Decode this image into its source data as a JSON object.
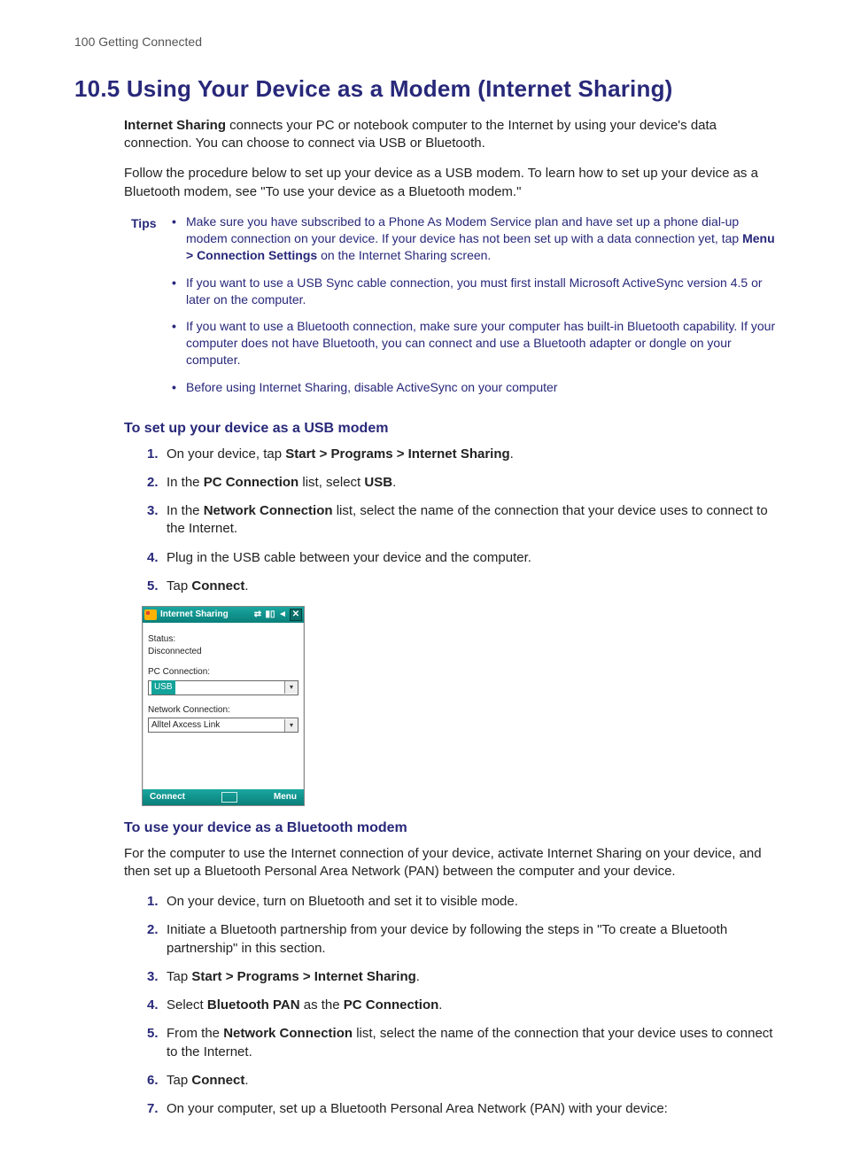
{
  "running_head": "100  Getting Connected",
  "title": "10.5  Using Your Device as a Modem (Internet Sharing)",
  "intro1_a": "Internet Sharing",
  "intro1_b": " connects your PC or notebook computer to the Internet by using your device's data connection. You can choose to connect via USB or Bluetooth.",
  "intro2": "Follow the procedure below to set up your device as a USB modem. To learn how to set up your device as a Bluetooth modem, see \"To use your device as a Bluetooth modem.\"",
  "tips_label": "Tips",
  "tips": [
    {
      "pre": "Make sure you have subscribed to a Phone As Modem Service plan and have set up a phone dial-up modem connection on your device. If your device has not been set up with a data connection yet, tap ",
      "strong": "Menu > Connection Settings",
      "post": " on the Internet Sharing screen."
    },
    {
      "pre": "If you want to use a USB Sync cable connection, you must first install Microsoft ActiveSync version 4.5 or later on the computer.",
      "strong": "",
      "post": ""
    },
    {
      "pre": "If you want to use a Bluetooth connection, make sure your computer has built-in Bluetooth capability. If your computer does not have Bluetooth, you can connect and use a Bluetooth adapter or dongle on your computer.",
      "strong": "",
      "post": ""
    },
    {
      "pre": "Before using Internet Sharing, disable ActiveSync on your computer",
      "strong": "",
      "post": ""
    }
  ],
  "usb_heading": "To set up your device as a USB modem",
  "usb_steps": [
    {
      "num": "1.",
      "pre": "On your device, tap ",
      "strong": "Start > Programs > Internet Sharing",
      "post": "."
    },
    {
      "num": "2.",
      "pre": "In the ",
      "strong": "PC Connection",
      "post": " list, select ",
      "strong2": "USB",
      "post2": "."
    },
    {
      "num": "3.",
      "pre": "In the ",
      "strong": "Network Connection",
      "post": " list, select the name of the connection that your device uses to connect to the Internet."
    },
    {
      "num": "4.",
      "pre": "Plug in the USB cable between your device and the computer.",
      "strong": "",
      "post": ""
    },
    {
      "num": "5.",
      "pre": "Tap ",
      "strong": "Connect",
      "post": "."
    }
  ],
  "shot": {
    "title": "Internet Sharing",
    "status_label": "Status:",
    "status_value": "Disconnected",
    "pc_label": "PC Connection:",
    "pc_value": "USB",
    "net_label": "Network Connection:",
    "net_value": "Alltel Axcess Link",
    "footer_left": "Connect",
    "footer_right": "Menu"
  },
  "bt_heading": "To use your device as a Bluetooth modem",
  "bt_intro": "For the computer to use the Internet connection of your device, activate Internet Sharing on your device, and then set up a Bluetooth Personal Area Network (PAN) between the computer and your device.",
  "bt_steps": [
    {
      "num": "1.",
      "pre": "On your device, turn on Bluetooth and set it to visible mode.",
      "strong": "",
      "post": ""
    },
    {
      "num": "2.",
      "pre": "Initiate a Bluetooth partnership from your device by following the steps in \"To create a Bluetooth partnership\" in this section.",
      "strong": "",
      "post": ""
    },
    {
      "num": "3.",
      "pre": "Tap ",
      "strong": "Start > Programs > Internet Sharing",
      "post": "."
    },
    {
      "num": "4.",
      "pre": "Select ",
      "strong": "Bluetooth PAN",
      "post": " as the ",
      "strong2": "PC Connection",
      "post2": "."
    },
    {
      "num": "5.",
      "pre": "From the ",
      "strong": "Network Connection",
      "post": " list, select the name of the connection that your device uses to connect to the Internet."
    },
    {
      "num": "6.",
      "pre": "Tap ",
      "strong": "Connect",
      "post": "."
    },
    {
      "num": "7.",
      "pre": "On your computer, set up a Bluetooth Personal Area Network (PAN) with your device:",
      "strong": "",
      "post": ""
    }
  ]
}
